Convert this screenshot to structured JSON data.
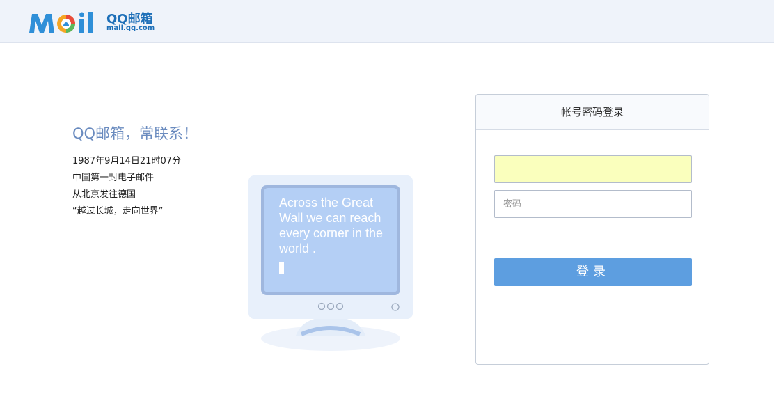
{
  "header": {
    "logo_word": "MOil",
    "logo_name": "QQ邮箱",
    "logo_url": "mail.qq.com"
  },
  "slogan": {
    "title": "QQ邮箱，常联系！",
    "lines": [
      "1987年9月14日21时07分",
      "中国第一封电子邮件",
      "从北京发往德国",
      "“越过长城，走向世界”"
    ]
  },
  "monitor": {
    "screen_text": "Across the Great Wall we can reach every corner in the world ."
  },
  "login": {
    "tab_title": "帐号密码登录",
    "username_value": "",
    "password_placeholder": "密码",
    "submit_label": "登录"
  },
  "colors": {
    "brand_blue": "#1d6fb8",
    "button_blue": "#5d9ee0",
    "autofill_yellow": "#faffbd",
    "slogan_blue": "#6a8bbf"
  }
}
